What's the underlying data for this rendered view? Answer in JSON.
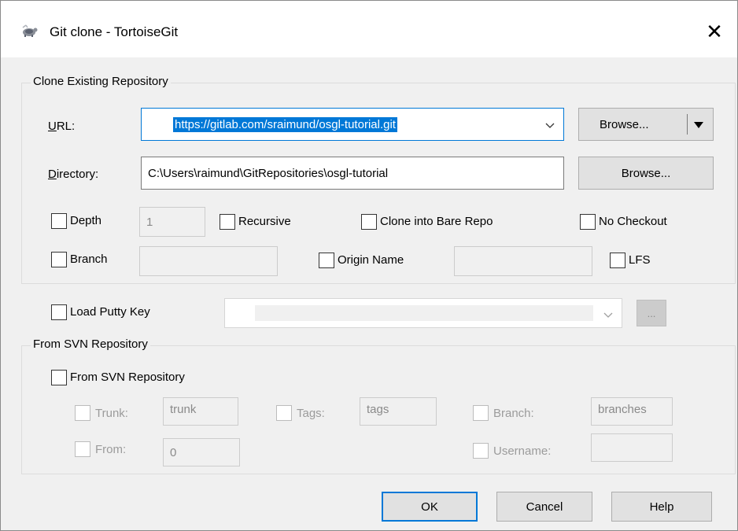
{
  "window": {
    "title": "Git clone - TortoiseGit",
    "close_glyph": "✕"
  },
  "clone_group": {
    "title": "Clone Existing Repository",
    "url_label": "URL:",
    "url_value": "https://gitlab.com/sraimund/osgl-tutorial.git",
    "url_browse_label": "Browse...",
    "directory_label": "Directory:",
    "directory_value": "C:\\Users\\raimund\\GitRepositories\\osgl-tutorial",
    "directory_browse_label": "Browse...",
    "depth_label": "Depth",
    "depth_value": "1",
    "recursive_label": "Recursive",
    "bare_repo_label": "Clone into Bare Repo",
    "no_checkout_label": "No Checkout",
    "branch_label": "Branch",
    "branch_value": "",
    "origin_name_label": "Origin Name",
    "origin_name_value": "",
    "lfs_label": "LFS"
  },
  "putty": {
    "label": "Load Putty Key",
    "value": "",
    "browse_label": "..."
  },
  "svn_group": {
    "title": "From SVN Repository",
    "from_svn_label": "From SVN Repository",
    "trunk_label": "Trunk:",
    "trunk_value": "trunk",
    "tags_label": "Tags:",
    "tags_value": "tags",
    "branch_label": "Branch:",
    "branch_value": "branches",
    "from_label": "From:",
    "from_value": "0",
    "username_label": "Username:",
    "username_value": ""
  },
  "buttons": {
    "ok": "OK",
    "cancel": "Cancel",
    "help": "Help"
  },
  "colors": {
    "accent": "#0078d7",
    "dialog_bg": "#f0f0f0"
  }
}
